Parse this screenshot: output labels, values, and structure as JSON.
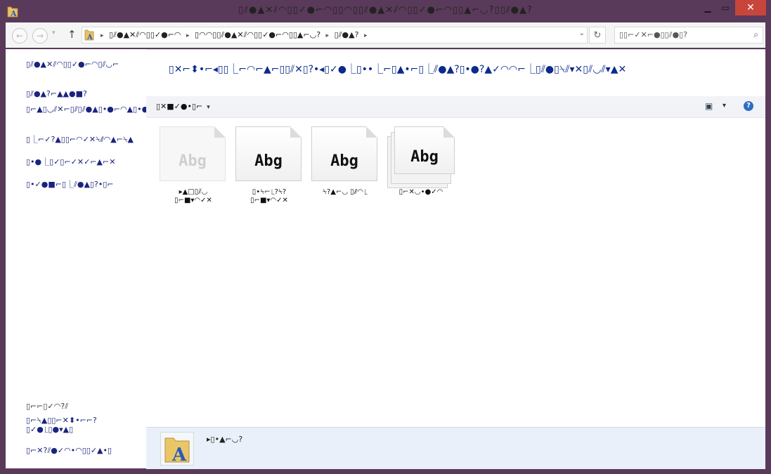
{
  "window": {
    "title": "▯⫽●▲✕⫽◠▯▯✓●⌐◠▯▯◠▯▯⫽●▲✕⫽◠▯▯✓●⌐◠▯▯▲⌐◡?▯▯⫽●▲?",
    "minimize_glyph": "▁",
    "maximize_glyph": "▭",
    "close_glyph": "✕"
  },
  "address_bar": {
    "back_glyph": "←",
    "forward_glyph": "→",
    "history_glyph": "▾",
    "up_glyph": "↑",
    "crumbs": [
      "▯⫽●▲✕⫽◠▯▯✓●⌐◠",
      "▯◠◠▯▯⫽●▲✕⫽◠▯▯✓●⌐◠▯▯▲⌐◡?",
      "▯⫽●▲?"
    ],
    "dropdown_glyph": "⌄",
    "refresh_glyph": "↻",
    "search_placeholder": "▯▯⌐✓✕⌐●▯▯⫽●▯?",
    "search_glyph": "⌕"
  },
  "left_pane": {
    "links": [
      "▯⫽●▲✕⫽◠▯▯✓●⌐◠▯⫽◡⌐",
      "▯⫽●▲?⌐▲▲●■?",
      "▯⌐▲▯◡⫽✕⌐▯⫽▯⫽●▲▯•●⌐◠▲▯•●⌐",
      "▯⎿⌐✓?▲▯▯⌐◠✓✕⍀⫽◠▲⌐⍀▲",
      "▯•●⎿▯✓▯⌐✓✕✓⌐▲⌐✕",
      "▯•✓●■⌐▯⎿⫽●▲▯?•▯⌐"
    ],
    "see_also": "▯⌐⌐▯✓◠?⫽",
    "bottom_links": [
      "▯⌐⍀▲▯▯⌐✕⬍•⌐⌐?▯✓●⎿▯●▾▲▯",
      "▯⌐✕?⫽●✓◠•◠▯▯✓▲•▯"
    ]
  },
  "main": {
    "heading": "▯✕⌐⬍•⌐◂▯▯⎿⌐◠⌐▲⌐▯▯⫽✕▯?•◂▯✓●⎿▯••⎿⌐▯▲•⌐▯⎿⫽●▲?▯•●?▲✓◠◠⌐⎿▯⫽●▯⍀⫽▾✕▯⫽◡⫽▾▲✕",
    "toolbar": {
      "organize_label": "▯✕■✓●•▯⌐",
      "organize_caret": "▾",
      "view_glyph": "▣",
      "view_caret": "▾",
      "help_glyph": "?"
    },
    "fonts": [
      {
        "sample": "Abg",
        "label": "▸▲□▯⫽◡ ▯⌐■▾◠✓✕",
        "style": "faded"
      },
      {
        "sample": "Abg",
        "label": "▯•⍀⌐⎿?⍀? ▯⌐■▾◠✓✕",
        "style": "normal"
      },
      {
        "sample": "Abg",
        "label": "⍀?▲⌐◡ ▯⫽◠⎿",
        "style": "normal"
      },
      {
        "sample": "Abg",
        "label": "▯⌐✕◡•●✓◠",
        "style": "stacked"
      }
    ]
  },
  "details": {
    "text": "▸▯•▲⌐◡?"
  }
}
